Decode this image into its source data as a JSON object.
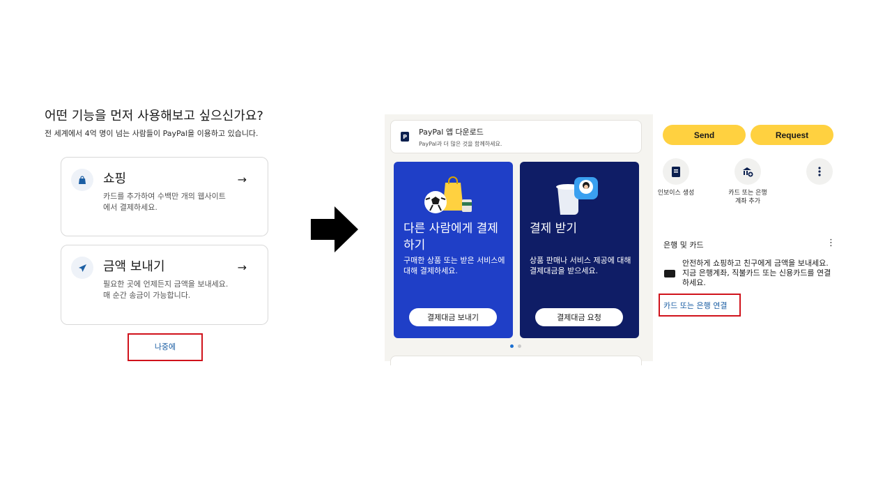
{
  "onboarding": {
    "title": "어떤 기능을 먼저 사용해보고 싶으신가요?",
    "subtitle": "전 세계에서 4억 명이 넘는 사람들이 PayPal을 이용하고 있습니다.",
    "options": [
      {
        "title": "쇼핑",
        "description": "카드를 추가하여 수백만 개의 웹사이트에서 결제하세요.",
        "icon": "shopping-bag-icon"
      },
      {
        "title": "금액 보내기",
        "description": "필요한 곳에 언제든지 금액을 보내세요. 매 순간 송금이 가능합니다.",
        "icon": "send-plane-icon"
      }
    ],
    "later_label": "나중에"
  },
  "app": {
    "download_banner": {
      "title": "PayPal 앱 다운로드",
      "subtitle": "PayPal과 더 많은 것을 함께하세요."
    },
    "promo_cards": [
      {
        "title": "다른 사람에게 결제하기",
        "description": "구매한 상품 또는 받은 서비스에 대해 결제하세요.",
        "button": "결제대금 보내기"
      },
      {
        "title": "결제 받기",
        "description": "상품 판매나 서비스 제공에 대해 결제대금을 받으세요.",
        "button": "결제대금 요청"
      }
    ]
  },
  "wallet": {
    "send_label": "Send",
    "request_label": "Request",
    "quick_actions": [
      {
        "label": "인보이스 생성",
        "icon": "invoice-icon"
      },
      {
        "label": "카드 또는 은행계좌 추가",
        "icon": "add-bank-icon"
      },
      {
        "label": "",
        "icon": "more-vertical-icon"
      }
    ],
    "bank_heading": "은행 및 카드",
    "bank_text": "안전하게 쇼핑하고 친구에게 금액을 보내세요. 지금 은행계좌, 직불카드 또는 신용카드를 연결하세요.",
    "link_label": "카드 또는 은행 연결"
  },
  "colors": {
    "paypal_blue": "#1f3fc7",
    "paypal_navy": "#0f1d66",
    "accent_yellow": "#ffd140",
    "highlight_red": "#d0121b"
  }
}
